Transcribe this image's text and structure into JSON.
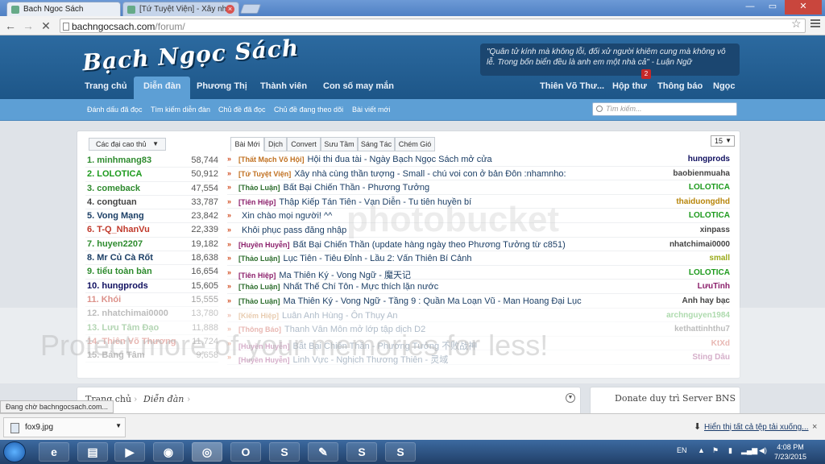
{
  "browser": {
    "tabs": [
      {
        "label": "Bach Ngoc Sách",
        "close": "×"
      },
      {
        "label": "[Tứ Tuyệt Viện] - Xây nhà",
        "close": "×"
      }
    ],
    "url_host": "bachngocsach.com",
    "url_path": "/forum/",
    "window_controls": [
      "—",
      "▭",
      "✕"
    ],
    "nav": {
      "back": "←",
      "forward": "→",
      "reload": "✕"
    },
    "star": "☆"
  },
  "site": {
    "logo": "Bạch Ngọc Sách",
    "quote": "\"Quân tử kính mà không lỗi, đối xử người khiêm cung mà không vô lễ. Trong bốn biển đều là anh em một nhà cả\" - Luận Ngữ",
    "nav_left": [
      "Trang chủ",
      "Diễn đàn",
      "Phương Thị",
      "Thành viên",
      "Con số may mắn"
    ],
    "nav_right": [
      "Thiên Võ Thư...",
      "Hộp thư",
      "Thông báo",
      "Ngọc"
    ],
    "inbox_count": "2",
    "subnav": [
      "Đánh dấu đã đọc",
      "Tìm kiếm diễn đàn",
      "Chủ đề đã đọc",
      "Chủ đề đang theo dõi",
      "Bài viết mới"
    ],
    "search_placeholder": "Tìm kiếm..."
  },
  "ranking": {
    "dropdown": "Các đại cao thủ",
    "rows": [
      {
        "name": "1. minhmang83",
        "value": "58,744",
        "color": "#2e8b2e"
      },
      {
        "name": "2. LOLOTICA",
        "value": "50,912",
        "color": "#1d9a1d"
      },
      {
        "name": "3. comeback",
        "value": "47,554",
        "color": "#2e8b2e"
      },
      {
        "name": "4. congtuan",
        "value": "33,787",
        "color": "#444444"
      },
      {
        "name": "5. Vong Mạng",
        "value": "23,842",
        "color": "#1c3f66"
      },
      {
        "name": "6. T-Q_NhanVu",
        "value": "22,339",
        "color": "#c0392b"
      },
      {
        "name": "7. huyen2207",
        "value": "19,182",
        "color": "#2e8b2e"
      },
      {
        "name": "8. Mr Củ Cà Rốt",
        "value": "18,638",
        "color": "#1c3f66"
      },
      {
        "name": "9. tiểu toàn bàn",
        "value": "16,654",
        "color": "#2e8b2e"
      },
      {
        "name": "10. hungprods",
        "value": "15,605",
        "color": "#101060"
      },
      {
        "name": "11. Khói",
        "value": "15,555",
        "color": "#c0392b"
      },
      {
        "name": "12. nhatchimai0000",
        "value": "13,780",
        "color": "#444444"
      },
      {
        "name": "13. Lưu Tâm Đạo",
        "value": "11,888",
        "color": "#2e8b2e"
      },
      {
        "name": "14. Thiên Võ Thương",
        "value": "11,724",
        "color": "#c0392b"
      },
      {
        "name": "15. Bảng Tâm",
        "value": "9,658",
        "color": "#444444"
      }
    ]
  },
  "forum": {
    "tabs": [
      "Bài Mới",
      "Dịch",
      "Convert",
      "Sưu Tầm",
      "Sáng Tác",
      "Chém Gió"
    ],
    "count_select": "15",
    "arrow": "»",
    "threads": [
      {
        "prefix": "[Thất Mạch Võ Hội]",
        "prefix_color": "#c07020",
        "title": "Hội thi đua tài - Ngày Bạch Ngọc Sách mở cửa",
        "user": "hungprods",
        "user_color": "#101060"
      },
      {
        "prefix": "[Tứ Tuyệt Viện]",
        "prefix_color": "#c07020",
        "title": "Xây nhà cùng thần tượng - Small - chú voi con ở bản Đôn :nhamnho:",
        "user": "baobienmuaha",
        "user_color": "#444444"
      },
      {
        "prefix": "[Thảo Luận]",
        "prefix_color": "#2e6e2e",
        "title": "Bất Bại Chiến Thần - Phương Tưởng",
        "user": "LOLOTICA",
        "user_color": "#1d9a1d"
      },
      {
        "prefix": "[Tiên Hiệp]",
        "prefix_color": "#8b1f6b",
        "title": "Thập Kiếp Tán Tiên - Vạn Diễn - Tu tiên huyền bí",
        "user": "thaiduongdhd",
        "user_color": "#b8860b"
      },
      {
        "prefix": "",
        "prefix_color": "#2e6e2e",
        "title": "Xin chào mọi người! ^^",
        "user": "LOLOTICA",
        "user_color": "#1d9a1d"
      },
      {
        "prefix": "",
        "prefix_color": "#2e6e2e",
        "title": "Khôi phục pass đăng nhập",
        "user": "xinpass",
        "user_color": "#444444"
      },
      {
        "prefix": "[Huyền Huyễn]",
        "prefix_color": "#8b1f6b",
        "title": "Bất Bại Chiến Thần (update hàng ngày theo Phương Tưởng từ c851)",
        "user": "nhatchimai0000",
        "user_color": "#444444"
      },
      {
        "prefix": "[Thảo Luận]",
        "prefix_color": "#2e6e2e",
        "title": "Lục Tiên - Tiêu Đỉnh - Lầu 2: Vấn Thiên Bí Cảnh",
        "user": "small",
        "user_color": "#9aaa1a"
      },
      {
        "prefix": "[Tiên Hiệp]",
        "prefix_color": "#8b1f6b",
        "title": "Ma Thiên Ký - Vong Ngữ - 魔天记",
        "user": "LOLOTICA",
        "user_color": "#1d9a1d"
      },
      {
        "prefix": "[Thảo Luận]",
        "prefix_color": "#2e6e2e",
        "title": "Nhất Thế Chí Tôn - Mực thích lặn nước",
        "user": "LưuTinh",
        "user_color": "#8b1f6b"
      },
      {
        "prefix": "[Thảo Luận]",
        "prefix_color": "#2e6e2e",
        "title": "Ma Thiên Ký - Vong Ngữ - Tầng 9 : Quần Ma Loạn Vũ - Man Hoang Đại Lục",
        "user": "Anh hay bạc",
        "user_color": "#444444"
      },
      {
        "prefix": "[Kiếm Hiệp]",
        "prefix_color": "#c07020",
        "title": "Luân Anh Hùng - Ôn Thụy An",
        "user": "archnguyen1984",
        "user_color": "#1d9a1d"
      },
      {
        "prefix": "[Thông Báo]",
        "prefix_color": "#c0392b",
        "title": "Thanh Vân Môn mở lớp tập dịch D2",
        "user": "kethattinhthu7",
        "user_color": "#444444"
      },
      {
        "prefix": "[Huyền Huyễn]",
        "prefix_color": "#8b1f6b",
        "title": "Bất Bại Chiến Thần - Phương Tưởng 不败战神",
        "user": "KtXd",
        "user_color": "#c0392b"
      },
      {
        "prefix": "[Huyền Huyễn]",
        "prefix_color": "#8b1f6b",
        "title": "Linh Vực - Nghịch Thương Thiên - 灵域",
        "user": "Sting Dâu",
        "user_color": "#8b1f6b"
      }
    ]
  },
  "watermark": "Protect more of your memories for less!",
  "watermark_logo": "photobucket",
  "breadcrumb": [
    "Trang chủ",
    "Diễn đàn"
  ],
  "donate_title": "Donate duy trì Server BNS",
  "status": "Đang chờ bachngocsach.com...",
  "downloads": {
    "file": "fox9.jpg",
    "show_all": "Hiển thị tất cả tệp tải xuống...",
    "close": "×"
  },
  "taskbar": {
    "lang": "EN",
    "time": "4:08 PM",
    "date": "7/23/2015"
  }
}
